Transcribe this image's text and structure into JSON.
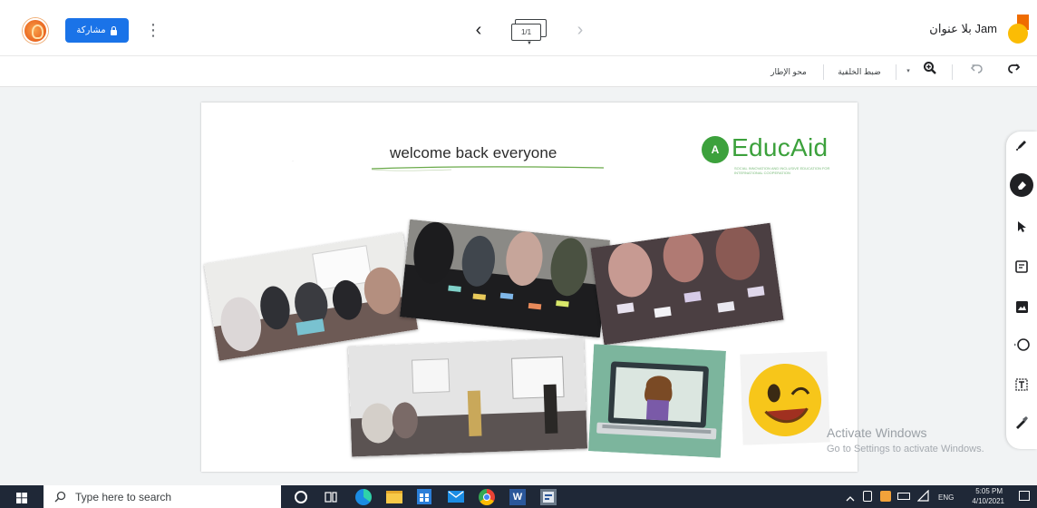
{
  "header": {
    "doc_title": "Jam بلا عنوان",
    "share_label": "مشاركة",
    "frame_counter": "1/1"
  },
  "toolbar": {
    "clear_frame_label": "محو الإطار",
    "set_background_label": "ضبط الخلفية"
  },
  "canvas": {
    "welcome_text": "welcome back everyone",
    "brand_name": "EducAid",
    "brand_tagline": "SOCIAL INNOVATION AND INCLUSIVE EDUCATION FOR INTERNATIONAL COOPERATION"
  },
  "watermark": {
    "line1": "Activate Windows",
    "line2": "Go to Settings to activate Windows."
  },
  "taskbar": {
    "search_placeholder": "Type here to search",
    "language": "ENG",
    "time": "5:05 PM",
    "date": "4/10/2021"
  },
  "colors": {
    "share_blue": "#1a73e8",
    "brand_green": "#3ca13c",
    "taskbar": "#1f2837"
  }
}
